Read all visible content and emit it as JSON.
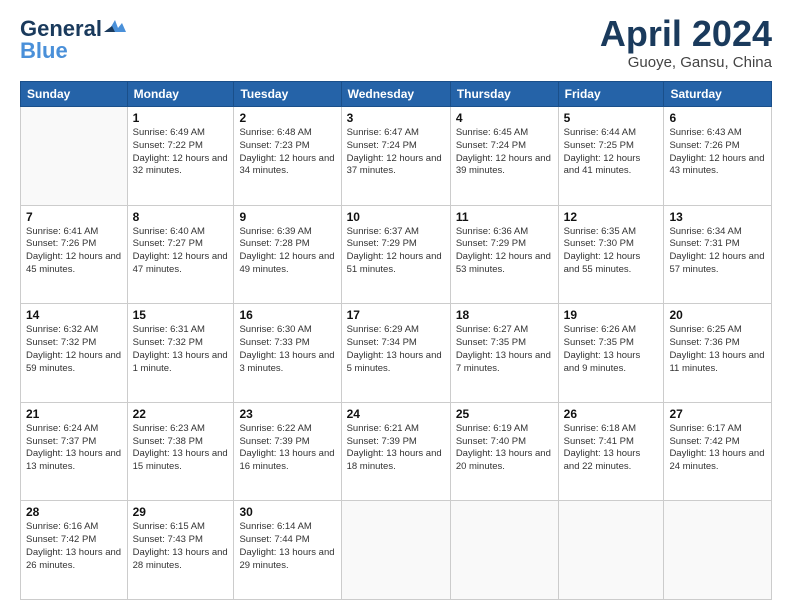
{
  "logo": {
    "line1": "General",
    "line2": "Blue"
  },
  "title": {
    "month_year": "April 2024",
    "location": "Guoye, Gansu, China"
  },
  "weekdays": [
    "Sunday",
    "Monday",
    "Tuesday",
    "Wednesday",
    "Thursday",
    "Friday",
    "Saturday"
  ],
  "weeks": [
    [
      {
        "day": "",
        "sunrise": "",
        "sunset": "",
        "daylight": ""
      },
      {
        "day": "1",
        "sunrise": "Sunrise: 6:49 AM",
        "sunset": "Sunset: 7:22 PM",
        "daylight": "Daylight: 12 hours and 32 minutes."
      },
      {
        "day": "2",
        "sunrise": "Sunrise: 6:48 AM",
        "sunset": "Sunset: 7:23 PM",
        "daylight": "Daylight: 12 hours and 34 minutes."
      },
      {
        "day": "3",
        "sunrise": "Sunrise: 6:47 AM",
        "sunset": "Sunset: 7:24 PM",
        "daylight": "Daylight: 12 hours and 37 minutes."
      },
      {
        "day": "4",
        "sunrise": "Sunrise: 6:45 AM",
        "sunset": "Sunset: 7:24 PM",
        "daylight": "Daylight: 12 hours and 39 minutes."
      },
      {
        "day": "5",
        "sunrise": "Sunrise: 6:44 AM",
        "sunset": "Sunset: 7:25 PM",
        "daylight": "Daylight: 12 hours and 41 minutes."
      },
      {
        "day": "6",
        "sunrise": "Sunrise: 6:43 AM",
        "sunset": "Sunset: 7:26 PM",
        "daylight": "Daylight: 12 hours and 43 minutes."
      }
    ],
    [
      {
        "day": "7",
        "sunrise": "Sunrise: 6:41 AM",
        "sunset": "Sunset: 7:26 PM",
        "daylight": "Daylight: 12 hours and 45 minutes."
      },
      {
        "day": "8",
        "sunrise": "Sunrise: 6:40 AM",
        "sunset": "Sunset: 7:27 PM",
        "daylight": "Daylight: 12 hours and 47 minutes."
      },
      {
        "day": "9",
        "sunrise": "Sunrise: 6:39 AM",
        "sunset": "Sunset: 7:28 PM",
        "daylight": "Daylight: 12 hours and 49 minutes."
      },
      {
        "day": "10",
        "sunrise": "Sunrise: 6:37 AM",
        "sunset": "Sunset: 7:29 PM",
        "daylight": "Daylight: 12 hours and 51 minutes."
      },
      {
        "day": "11",
        "sunrise": "Sunrise: 6:36 AM",
        "sunset": "Sunset: 7:29 PM",
        "daylight": "Daylight: 12 hours and 53 minutes."
      },
      {
        "day": "12",
        "sunrise": "Sunrise: 6:35 AM",
        "sunset": "Sunset: 7:30 PM",
        "daylight": "Daylight: 12 hours and 55 minutes."
      },
      {
        "day": "13",
        "sunrise": "Sunrise: 6:34 AM",
        "sunset": "Sunset: 7:31 PM",
        "daylight": "Daylight: 12 hours and 57 minutes."
      }
    ],
    [
      {
        "day": "14",
        "sunrise": "Sunrise: 6:32 AM",
        "sunset": "Sunset: 7:32 PM",
        "daylight": "Daylight: 12 hours and 59 minutes."
      },
      {
        "day": "15",
        "sunrise": "Sunrise: 6:31 AM",
        "sunset": "Sunset: 7:32 PM",
        "daylight": "Daylight: 13 hours and 1 minute."
      },
      {
        "day": "16",
        "sunrise": "Sunrise: 6:30 AM",
        "sunset": "Sunset: 7:33 PM",
        "daylight": "Daylight: 13 hours and 3 minutes."
      },
      {
        "day": "17",
        "sunrise": "Sunrise: 6:29 AM",
        "sunset": "Sunset: 7:34 PM",
        "daylight": "Daylight: 13 hours and 5 minutes."
      },
      {
        "day": "18",
        "sunrise": "Sunrise: 6:27 AM",
        "sunset": "Sunset: 7:35 PM",
        "daylight": "Daylight: 13 hours and 7 minutes."
      },
      {
        "day": "19",
        "sunrise": "Sunrise: 6:26 AM",
        "sunset": "Sunset: 7:35 PM",
        "daylight": "Daylight: 13 hours and 9 minutes."
      },
      {
        "day": "20",
        "sunrise": "Sunrise: 6:25 AM",
        "sunset": "Sunset: 7:36 PM",
        "daylight": "Daylight: 13 hours and 11 minutes."
      }
    ],
    [
      {
        "day": "21",
        "sunrise": "Sunrise: 6:24 AM",
        "sunset": "Sunset: 7:37 PM",
        "daylight": "Daylight: 13 hours and 13 minutes."
      },
      {
        "day": "22",
        "sunrise": "Sunrise: 6:23 AM",
        "sunset": "Sunset: 7:38 PM",
        "daylight": "Daylight: 13 hours and 15 minutes."
      },
      {
        "day": "23",
        "sunrise": "Sunrise: 6:22 AM",
        "sunset": "Sunset: 7:39 PM",
        "daylight": "Daylight: 13 hours and 16 minutes."
      },
      {
        "day": "24",
        "sunrise": "Sunrise: 6:21 AM",
        "sunset": "Sunset: 7:39 PM",
        "daylight": "Daylight: 13 hours and 18 minutes."
      },
      {
        "day": "25",
        "sunrise": "Sunrise: 6:19 AM",
        "sunset": "Sunset: 7:40 PM",
        "daylight": "Daylight: 13 hours and 20 minutes."
      },
      {
        "day": "26",
        "sunrise": "Sunrise: 6:18 AM",
        "sunset": "Sunset: 7:41 PM",
        "daylight": "Daylight: 13 hours and 22 minutes."
      },
      {
        "day": "27",
        "sunrise": "Sunrise: 6:17 AM",
        "sunset": "Sunset: 7:42 PM",
        "daylight": "Daylight: 13 hours and 24 minutes."
      }
    ],
    [
      {
        "day": "28",
        "sunrise": "Sunrise: 6:16 AM",
        "sunset": "Sunset: 7:42 PM",
        "daylight": "Daylight: 13 hours and 26 minutes."
      },
      {
        "day": "29",
        "sunrise": "Sunrise: 6:15 AM",
        "sunset": "Sunset: 7:43 PM",
        "daylight": "Daylight: 13 hours and 28 minutes."
      },
      {
        "day": "30",
        "sunrise": "Sunrise: 6:14 AM",
        "sunset": "Sunset: 7:44 PM",
        "daylight": "Daylight: 13 hours and 29 minutes."
      },
      {
        "day": "",
        "sunrise": "",
        "sunset": "",
        "daylight": ""
      },
      {
        "day": "",
        "sunrise": "",
        "sunset": "",
        "daylight": ""
      },
      {
        "day": "",
        "sunrise": "",
        "sunset": "",
        "daylight": ""
      },
      {
        "day": "",
        "sunrise": "",
        "sunset": "",
        "daylight": ""
      }
    ]
  ]
}
